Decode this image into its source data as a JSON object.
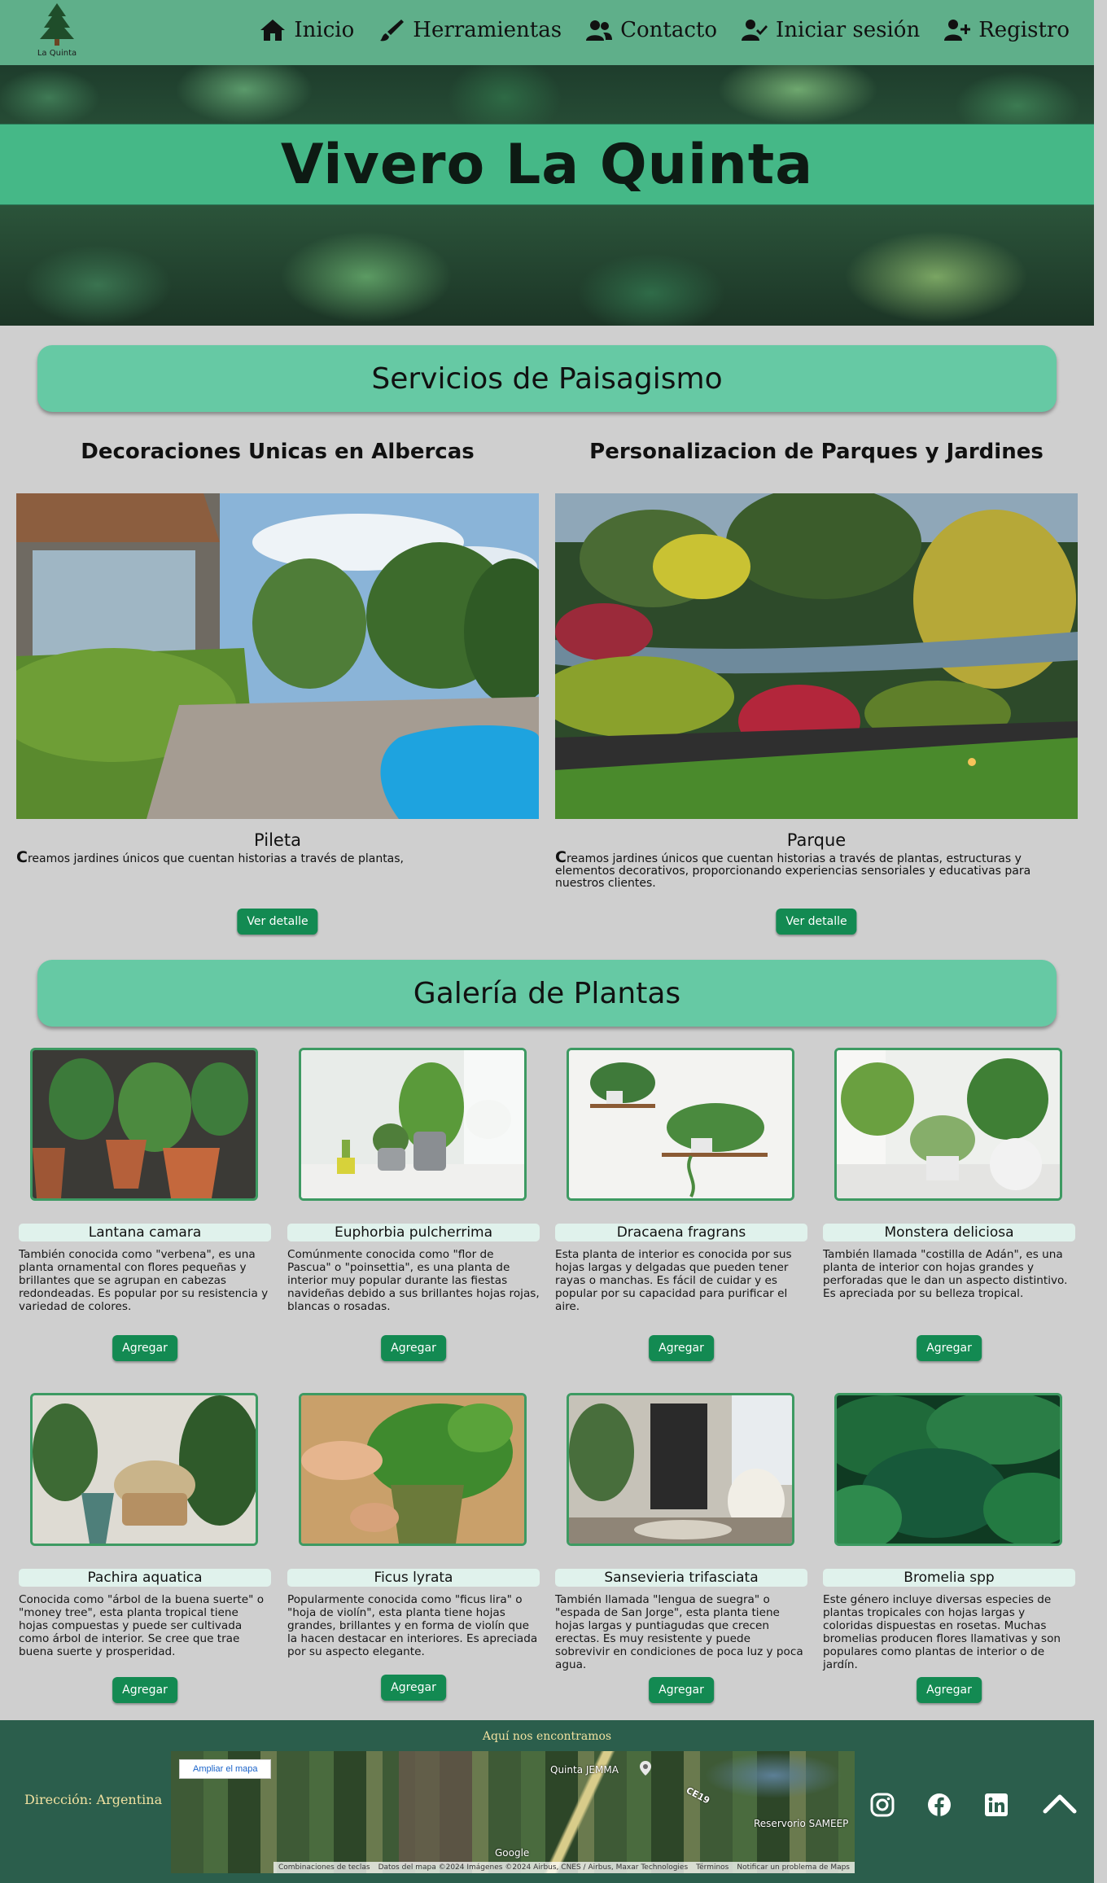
{
  "nav": {
    "logo_text": "La Quinta",
    "links": [
      {
        "label": "Inicio",
        "icon": "home-icon"
      },
      {
        "label": "Herramientas",
        "icon": "brush-icon"
      },
      {
        "label": "Contacto",
        "icon": "users-icon"
      },
      {
        "label": "Iniciar sesión",
        "icon": "user-check-icon"
      },
      {
        "label": "Registro",
        "icon": "user-plus-icon"
      }
    ]
  },
  "hero": {
    "title": "Vivero La Quinta"
  },
  "services": {
    "title": "Servicios de Paisagismo",
    "items": [
      {
        "heading": "Decoraciones Unicas en Albercas",
        "caption": "Pileta",
        "text_initial": "C",
        "text_rest": "reamos jardines únicos que cuentan historias a través de plantas,",
        "button": "Ver detalle"
      },
      {
        "heading": "Personalizacion de Parques y Jardines",
        "caption": "Parque",
        "text_initial": "C",
        "text_rest": "reamos jardines únicos que cuentan historias a través de plantas, estructuras y elementos decorativos, proporcionando experiencias sensoriales y educativas para nuestros clientes.",
        "button": "Ver detalle"
      }
    ]
  },
  "gallery": {
    "title": "Galería de Plantas",
    "button_label": "Agregar",
    "plants": [
      {
        "name": "Lantana camara",
        "desc": "También conocida como \"verbena\", es una planta ornamental con flores pequeñas y brillantes que se agrupan en cabezas redondeadas. Es popular por su resistencia y variedad de colores."
      },
      {
        "name": "Euphorbia pulcherrima",
        "desc": "Comúnmente conocida como \"flor de Pascua\" o \"poinsettia\", es una planta de interior muy popular durante las fiestas navideñas debido a sus brillantes hojas rojas, blancas o rosadas."
      },
      {
        "name": "Dracaena fragrans",
        "desc": "Esta planta de interior es conocida por sus hojas largas y delgadas que pueden tener rayas o manchas. Es fácil de cuidar y es popular por su capacidad para purificar el aire."
      },
      {
        "name": "Monstera deliciosa",
        "desc": "También llamada \"costilla de Adán\", es una planta de interior con hojas grandes y perforadas que le dan un aspecto distintivo. Es apreciada por su belleza tropical."
      },
      {
        "name": "Pachira aquatica",
        "desc": "Conocida como \"árbol de la buena suerte\" o \"money tree\", esta planta tropical tiene hojas compuestas y puede ser cultivada como árbol de interior. Se cree que trae buena suerte y prosperidad."
      },
      {
        "name": "Ficus lyrata",
        "desc": "Popularmente conocida como \"ficus lira\" o \"hoja de violín\", esta planta tiene hojas grandes, brillantes y en forma de violín que la hacen destacar en interiores. Es apreciada por su aspecto elegante."
      },
      {
        "name": "Sansevieria trifasciata",
        "desc": "También llamada \"lengua de suegra\" o \"espada de San Jorge\", esta planta tiene hojas largas y puntiagudas que crecen erectas. Es muy resistente y puede sobrevivir en condiciones de poca luz y poca agua."
      },
      {
        "name": "Bromelia spp",
        "desc": "Este género incluye diversas especies de plantas tropicales con hojas largas y coloridas dispuestas en rosetas. Muchas bromelias producen flores llamativas y son populares como plantas de interior o de jardín."
      }
    ]
  },
  "footer": {
    "title": "Aquí nos encontramos",
    "address": "Dirección: Argentina",
    "map": {
      "enlarge": "Ampliar el mapa",
      "place": "Quinta JEMMA",
      "road": "CE19",
      "reservoir": "Reservorio SAMEEP",
      "brand": "Google",
      "attribution": [
        "Combinaciones de teclas",
        "Datos del mapa ©2024 Imágenes ©2024 Airbus, CNES / Airbus, Maxar Technologies",
        "Términos",
        "Notificar un problema de Maps"
      ]
    },
    "social": [
      "instagram-icon",
      "facebook-icon",
      "linkedin-icon"
    ],
    "top_icon": "chevron-up-icon"
  },
  "colors": {
    "nav_bg": "#5faf8a",
    "hero_band": "#45b887",
    "banner": "#66c9a4",
    "button": "#138a52",
    "footer_bg": "#2b5e4c",
    "footer_text": "#f1e1a0",
    "page_bg": "#cfcfcf"
  }
}
